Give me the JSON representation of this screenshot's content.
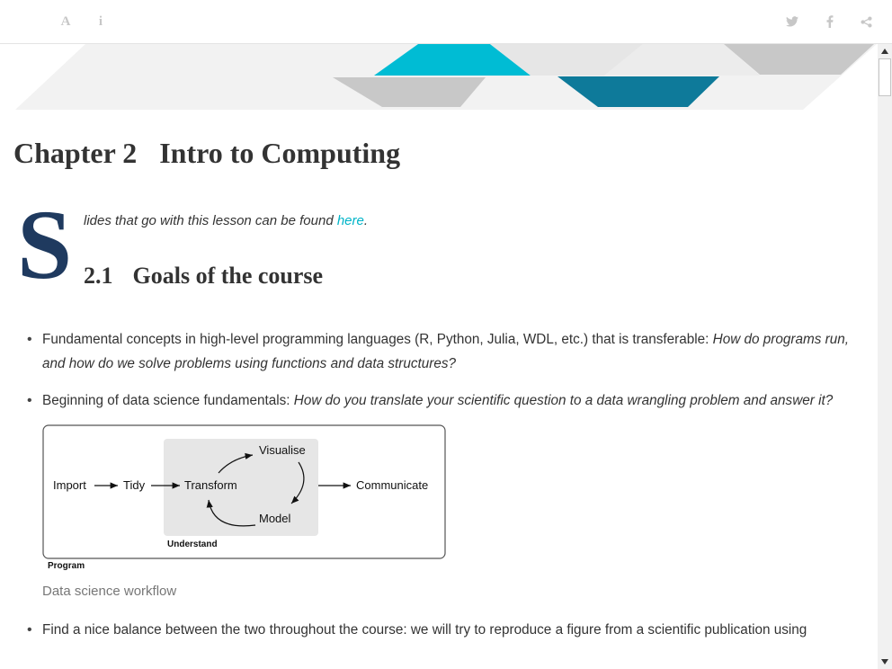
{
  "toolbar": {
    "left_icons": [
      "font-settings-icon",
      "info-icon"
    ],
    "right_icons": [
      "twitter-icon",
      "facebook-icon",
      "share-icon"
    ],
    "font_glyph": "A",
    "info_glyph": "i"
  },
  "chapter": {
    "number": "Chapter 2",
    "title": "Intro to Computing"
  },
  "intro": {
    "dropcap": "S",
    "text_before_link": "lides that go with this lesson can be found ",
    "link_text": "here",
    "text_after_link": "."
  },
  "section": {
    "number": "2.1",
    "title": "Goals of the course"
  },
  "goals": [
    {
      "text": "Fundamental concepts in high-level programming languages (R, Python, Julia, WDL, etc.) that is transferable: ",
      "emphasis": "How do programs run, and how do we solve problems using functions and data structures?"
    },
    {
      "text": "Beginning of data science fundamentals: ",
      "emphasis": "How do you translate your scientific question to a data wrangling problem and answer it?"
    },
    {
      "text": "Find a nice balance between the two throughout the course: we will try to reproduce a figure from a scientific publication using"
    }
  ],
  "figure": {
    "labels": {
      "import": "Import",
      "tidy": "Tidy",
      "transform": "Transform",
      "visualise": "Visualise",
      "model": "Model",
      "communicate": "Communicate",
      "understand": "Understand",
      "program": "Program"
    },
    "caption": "Data science workflow"
  },
  "colors": {
    "accent": "#00b4c8",
    "dropcap": "#1f3a5f",
    "banner_teal": "#00bcd4",
    "banner_dark_teal": "#0e7a9a",
    "banner_gray": "#c8c8c8"
  }
}
